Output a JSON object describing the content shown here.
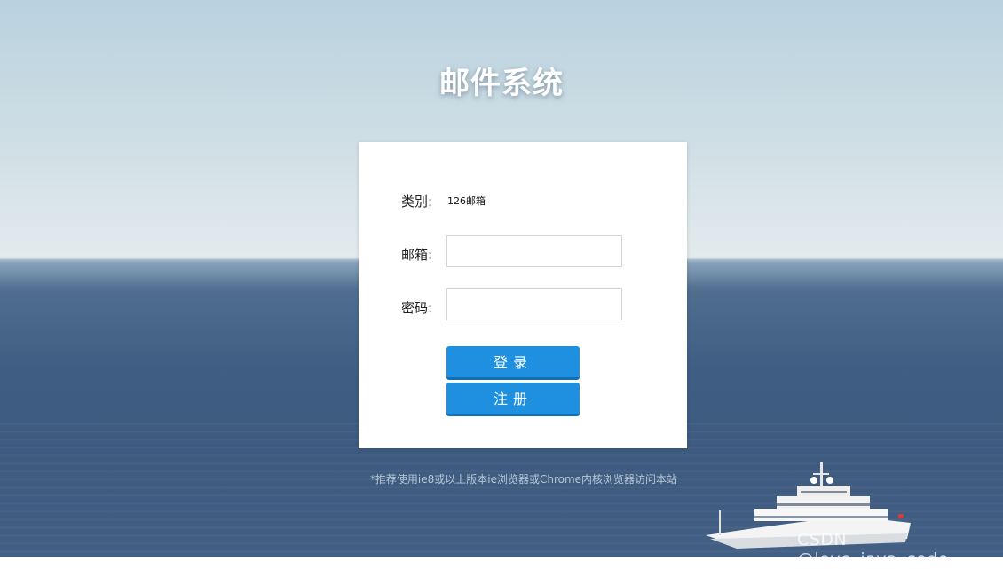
{
  "page": {
    "title": "邮件系统"
  },
  "form": {
    "category_label": "类别:",
    "category_value": "126邮箱",
    "email_label": "邮箱:",
    "email_value": "",
    "email_placeholder": "",
    "password_label": "密码:",
    "password_value": "",
    "password_placeholder": "",
    "login_button": "登录",
    "register_button": "注册"
  },
  "footer": {
    "note": "*推荐使用ie8或以上版本ie浏览器或Chrome内核浏览器访问本站",
    "watermark": "CSDN @love_java_code"
  },
  "colors": {
    "button": "#1f8fe0",
    "panel": "#ffffff",
    "title": "#ffffff"
  }
}
